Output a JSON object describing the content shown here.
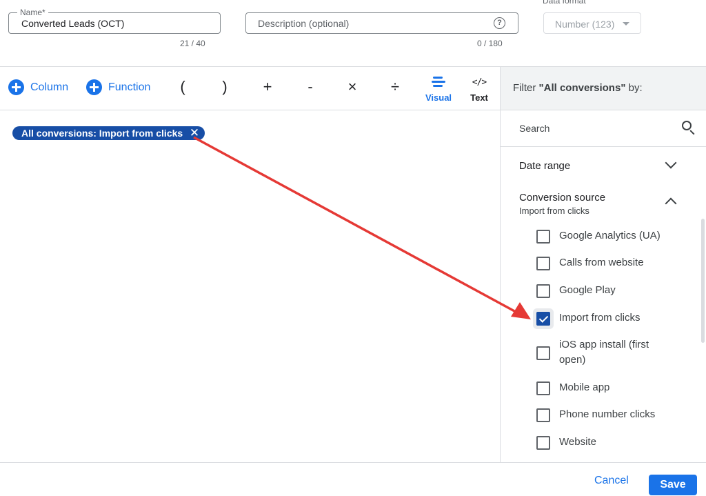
{
  "form": {
    "name_label": "Name*",
    "name_value": "Converted Leads (OCT)",
    "name_counter": "21 / 40",
    "description_placeholder": "Description (optional)",
    "description_counter": "0 / 180",
    "data_format_label": "Data format",
    "data_format_value": "Number (123)",
    "help_icon": "?"
  },
  "toolbar": {
    "column_label": "Column",
    "function_label": "Function",
    "operators": [
      "(",
      ")",
      "+",
      "-",
      "×",
      "÷"
    ],
    "visual_label": "Visual",
    "text_label": "Text",
    "text_glyph": "</>"
  },
  "editor": {
    "chip_label": "All conversions: Import from clicks",
    "chip_remove": "✕"
  },
  "filter": {
    "title_prefix": "Filter ",
    "title_bold": "\"All conversions\"",
    "title_suffix": " by:",
    "search_placeholder": "Search",
    "sections": [
      {
        "title": "Date range",
        "expanded": false
      },
      {
        "title": "Conversion source",
        "subtitle": "Import from clicks",
        "expanded": true
      }
    ],
    "options": [
      {
        "label": "Google Analytics (UA)",
        "checked": false
      },
      {
        "label": "Calls from website",
        "checked": false
      },
      {
        "label": "Google Play",
        "checked": false
      },
      {
        "label": "Import from clicks",
        "checked": true
      },
      {
        "label": "iOS app install (first open)",
        "checked": false
      },
      {
        "label": "Mobile app",
        "checked": false
      },
      {
        "label": "Phone number clicks",
        "checked": false
      },
      {
        "label": "Website",
        "checked": false
      }
    ]
  },
  "footer": {
    "cancel_label": "Cancel",
    "save_label": "Save"
  },
  "colors": {
    "accent": "#1a73e8",
    "chip": "#174ea6",
    "annotation_arrow": "#e53935"
  }
}
